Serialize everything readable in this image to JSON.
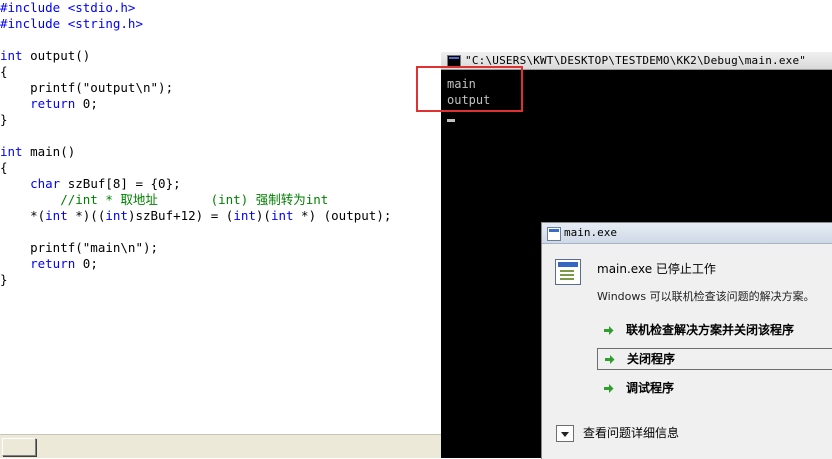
{
  "editor": {
    "lines": [
      [
        {
          "t": "#include <stdio.h>",
          "c": "kw"
        }
      ],
      [
        {
          "t": "#include <string.h>",
          "c": "kw"
        }
      ],
      [],
      [
        {
          "t": "int",
          "c": "kw"
        },
        {
          "t": " output()"
        }
      ],
      [
        {
          "t": "{"
        }
      ],
      [
        {
          "t": "    printf(\"output\\n\");"
        }
      ],
      [
        {
          "t": "    "
        },
        {
          "t": "return",
          "c": "kw"
        },
        {
          "t": " 0;"
        }
      ],
      [
        {
          "t": "}"
        }
      ],
      [],
      [
        {
          "t": "int",
          "c": "kw"
        },
        {
          "t": " main()"
        }
      ],
      [
        {
          "t": "{"
        }
      ],
      [
        {
          "t": "    "
        },
        {
          "t": "char",
          "c": "kw"
        },
        {
          "t": " szBuf[8] = {0};"
        }
      ],
      [
        {
          "t": "        //int * 取地址       (int) 强制转为int",
          "c": "cm"
        }
      ],
      [
        {
          "t": "    *("
        },
        {
          "t": "int",
          "c": "kw"
        },
        {
          "t": " *)(("
        },
        {
          "t": "int",
          "c": "kw"
        },
        {
          "t": ")szBuf+12) = ("
        },
        {
          "t": "int",
          "c": "kw"
        },
        {
          "t": ")("
        },
        {
          "t": "int",
          "c": "kw"
        },
        {
          "t": " *) (output);"
        }
      ],
      [],
      [
        {
          "t": "    printf(\"main\\n\");"
        }
      ],
      [
        {
          "t": "    "
        },
        {
          "t": "return",
          "c": "kw"
        },
        {
          "t": " 0;"
        }
      ],
      [
        {
          "t": "}"
        }
      ]
    ]
  },
  "console": {
    "title": "\"C:\\USERS\\KWT\\DESKTOP\\TESTDEMO\\KK2\\Debug\\main.exe\"",
    "output": [
      "main",
      "output"
    ]
  },
  "dialog": {
    "title": "main.exe",
    "heading": "main.exe 已停止工作",
    "subtext": "Windows 可以联机检查该问题的解决方案。",
    "options": [
      {
        "label": "联机检查解决方案并关闭该程序",
        "selected": false
      },
      {
        "label": "关闭程序",
        "selected": true
      },
      {
        "label": "调试程序",
        "selected": false
      }
    ],
    "details_label": "查看问题详细信息"
  },
  "colors": {
    "keyword": "#0000ff",
    "comment": "#008000",
    "highlight": "#e03030",
    "arrow": "#2f9e2f"
  }
}
